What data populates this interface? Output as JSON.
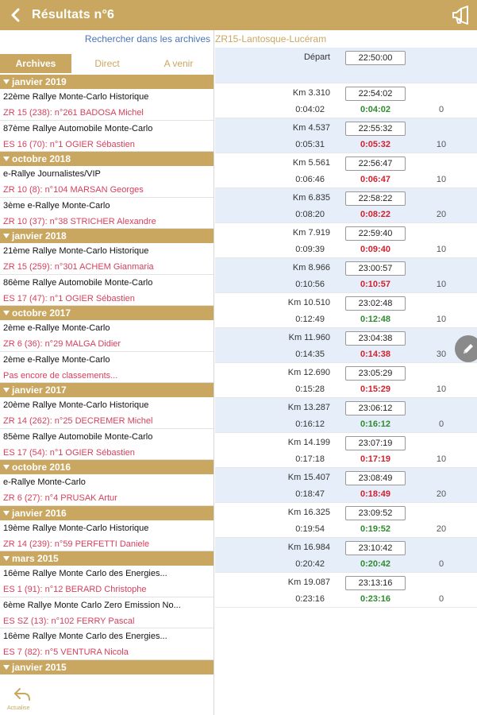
{
  "header": {
    "title": "Résultats n°6"
  },
  "left": {
    "search_label": "Rechercher dans les archives",
    "tabs": [
      "Archives",
      "Direct",
      "A venir"
    ],
    "list": [
      {
        "type": "month",
        "label": "janvier 2019"
      },
      {
        "type": "rally",
        "name": "22ème Rallye Monte-Carlo Historique",
        "sub": "ZR 15 (238): n°261 BADOSA Michel"
      },
      {
        "type": "rally",
        "name": "87ème Rallye Automobile Monte-Carlo",
        "sub": "ES 16 (70): n°1 OGIER Sébastien"
      },
      {
        "type": "month",
        "label": "octobre 2018"
      },
      {
        "type": "rally",
        "name": "e-Rallye Journalistes/VIP",
        "sub": "ZR 10 (8): n°104 MARSAN Georges"
      },
      {
        "type": "rally",
        "name": "3ème e-Rallye Monte-Carlo",
        "sub": "ZR 10 (37): n°38 STRICHER Alexandre"
      },
      {
        "type": "month",
        "label": "janvier 2018"
      },
      {
        "type": "rally",
        "name": "21ème Rallye Monte-Carlo Historique",
        "sub": "ZR 15 (259): n°301 ACHEM Gianmaria"
      },
      {
        "type": "rally",
        "name": "86ème Rallye Automobile Monte-Carlo",
        "sub": "ES 17 (47): n°1 OGIER Sébastien"
      },
      {
        "type": "month",
        "label": "octobre 2017"
      },
      {
        "type": "rally",
        "name": "2ème e-Rallye Monte-Carlo",
        "sub": "ZR 6 (36): n°29 MALGA Didier"
      },
      {
        "type": "rally",
        "name": "2ème e-Rallye Monte-Carlo",
        "sub": "Pas encore de classements..."
      },
      {
        "type": "month",
        "label": "janvier 2017"
      },
      {
        "type": "rally",
        "name": "20ème Rallye Monte-Carlo Historique",
        "sub": "ZR 14 (262): n°25 DECREMER Michel"
      },
      {
        "type": "rally",
        "name": "85ème Rallye Automobile Monte-Carlo",
        "sub": "ES 17 (54): n°1 OGIER Sébastien"
      },
      {
        "type": "month",
        "label": "octobre 2016"
      },
      {
        "type": "rally",
        "name": "e-Rallye Monte-Carlo",
        "sub": "ZR 6 (27): n°4 PRUSAK Artur"
      },
      {
        "type": "month",
        "label": "janvier 2016"
      },
      {
        "type": "rally",
        "name": "19ème Rallye Monte-Carlo Historique",
        "sub": "ZR 14 (239): n°59 PERFETTI Daniele"
      },
      {
        "type": "month",
        "label": "mars 2015"
      },
      {
        "type": "rally",
        "name": "16ème Rallye Monte Carlo des Energies...",
        "sub": "ES 1 (91): n°12 BERARD Christophe"
      },
      {
        "type": "rally",
        "name": "6ème Rallye Monte Carlo Zero Emission No...",
        "sub": "ES SZ (13): n°102 FERRY Pascal"
      },
      {
        "type": "rally",
        "name": "16ème Rallye Monte Carlo des Energies...",
        "sub": "ES 7 (82): n°5 VENTURA Nicola"
      },
      {
        "type": "month",
        "label": "janvier 2015"
      }
    ],
    "actualise_label": "Actualise"
  },
  "right": {
    "stage_title": "ZR15-Lantosque-Lucéram",
    "depart_label": "Départ",
    "depart_time": "22:50:00",
    "rows": [
      {
        "km": "Km 3.310",
        "time": "22:54:02",
        "elapsed": "0:04:02",
        "diff": "0:04:02",
        "status": "green",
        "pen": "0"
      },
      {
        "km": "Km 4.537",
        "time": "22:55:32",
        "elapsed": "0:05:31",
        "diff": "0:05:32",
        "status": "red",
        "pen": "10"
      },
      {
        "km": "Km 5.561",
        "time": "22:56:47",
        "elapsed": "0:06:46",
        "diff": "0:06:47",
        "status": "red",
        "pen": "10"
      },
      {
        "km": "Km 6.835",
        "time": "22:58:22",
        "elapsed": "0:08:20",
        "diff": "0:08:22",
        "status": "red",
        "pen": "20"
      },
      {
        "km": "Km 7.919",
        "time": "22:59:40",
        "elapsed": "0:09:39",
        "diff": "0:09:40",
        "status": "red",
        "pen": "10"
      },
      {
        "km": "Km 8.966",
        "time": "23:00:57",
        "elapsed": "0:10:56",
        "diff": "0:10:57",
        "status": "red",
        "pen": "10"
      },
      {
        "km": "Km 10.510",
        "time": "23:02:48",
        "elapsed": "0:12:49",
        "diff": "0:12:48",
        "status": "green",
        "pen": "10"
      },
      {
        "km": "Km 11.960",
        "time": "23:04:38",
        "elapsed": "0:14:35",
        "diff": "0:14:38",
        "status": "red",
        "pen": "30"
      },
      {
        "km": "Km 12.690",
        "time": "23:05:29",
        "elapsed": "0:15:28",
        "diff": "0:15:29",
        "status": "red",
        "pen": "10"
      },
      {
        "km": "Km 13.287",
        "time": "23:06:12",
        "elapsed": "0:16:12",
        "diff": "0:16:12",
        "status": "green",
        "pen": "0"
      },
      {
        "km": "Km 14.199",
        "time": "23:07:19",
        "elapsed": "0:17:18",
        "diff": "0:17:19",
        "status": "red",
        "pen": "10"
      },
      {
        "km": "Km 15.407",
        "time": "23:08:49",
        "elapsed": "0:18:47",
        "diff": "0:18:49",
        "status": "red",
        "pen": "20"
      },
      {
        "km": "Km 16.325",
        "time": "23:09:52",
        "elapsed": "0:19:54",
        "diff": "0:19:52",
        "status": "green",
        "pen": "20"
      },
      {
        "km": "Km 16.984",
        "time": "23:10:42",
        "elapsed": "0:20:42",
        "diff": "0:20:42",
        "status": "green",
        "pen": "0"
      },
      {
        "km": "Km 19.087",
        "time": "23:13:16",
        "elapsed": "0:23:16",
        "diff": "0:23:16",
        "status": "green",
        "pen": "0"
      }
    ]
  },
  "colors": {
    "accent": "#c9a760",
    "red": "#d21f2d",
    "green": "#2e8b2e",
    "link": "#4b73b9",
    "rowAlt": "#e6eff9"
  },
  "icons": {
    "back": "chevron-left-icon",
    "megaphone": "megaphone-icon",
    "edit": "pencil-icon",
    "refresh": "reply-arrow-icon"
  }
}
